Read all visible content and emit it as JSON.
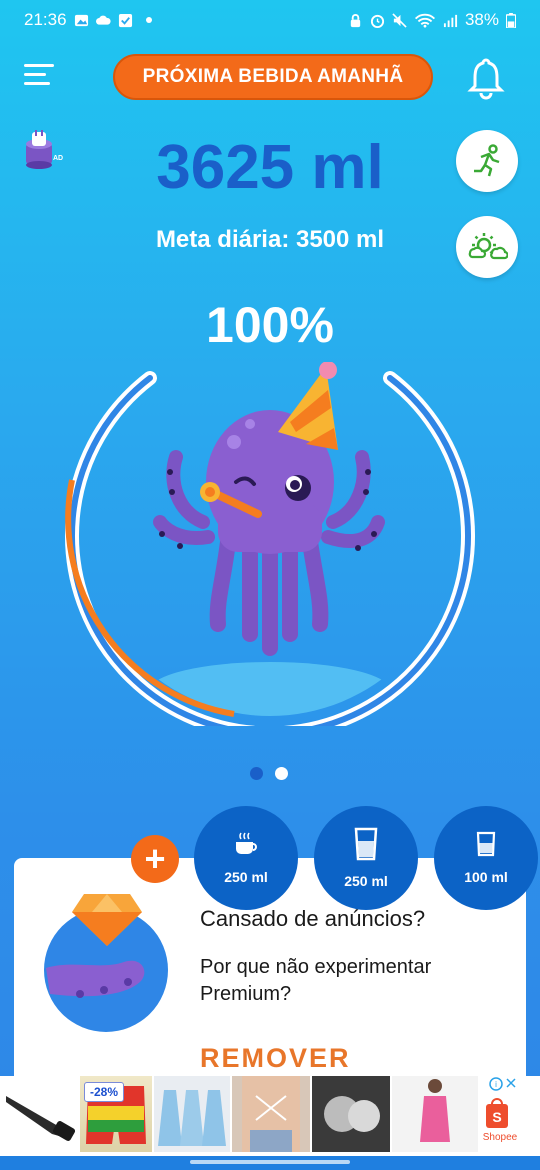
{
  "status_bar": {
    "time": "21:36",
    "battery": "38%"
  },
  "header": {
    "next_drink_label": "PRÓXIMA BEBIDA AMANHÃ"
  },
  "ad_badge": {
    "label": "AD"
  },
  "intake": {
    "total": "3625 ml",
    "goal": "Meta diária: 3500 ml",
    "percent": "100%",
    "progress": 1.0
  },
  "drinks": [
    {
      "label": "250 ml",
      "icon": "coffee-cup-icon"
    },
    {
      "label": "250 ml",
      "icon": "water-glass-icon"
    },
    {
      "label": "100 ml",
      "icon": "small-glass-icon"
    }
  ],
  "premium_ad": {
    "title": "Cansado de anúncios?",
    "description": "Por que não experimentar Premium?",
    "action": "REMOVER"
  },
  "banner": {
    "discount": "-28%",
    "store": "Shopee"
  },
  "colors": {
    "accent": "#f36a19",
    "primary": "#1a5fc9",
    "button": "#0c63c6"
  }
}
